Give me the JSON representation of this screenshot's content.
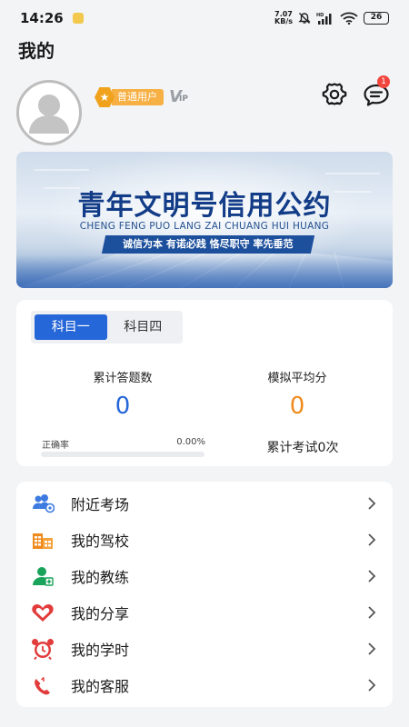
{
  "status_bar": {
    "time": "14:26",
    "net_speed_value": "7.07",
    "net_speed_unit": "KB/s",
    "battery": "26"
  },
  "header": {
    "title": "我的"
  },
  "profile": {
    "user_type": "普通用户",
    "vip_v": "V",
    "vip_ip": "IP",
    "message_count": "1"
  },
  "banner": {
    "title": "青年文明号信用公约",
    "subtitle": "CHENG FENG PUO LANG ZAI CHUANG HUI HUANG",
    "slogan": "诚信为本 有诺必践 恪尽职守 率先垂范"
  },
  "stats": {
    "tabs": [
      {
        "label": "科目一",
        "active": true
      },
      {
        "label": "科目四",
        "active": false
      }
    ],
    "answered_label": "累计答题数",
    "answered_value": "0",
    "answered_color": "#2566d8",
    "avg_label": "模拟平均分",
    "avg_value": "0",
    "avg_color": "#f08a1c",
    "accuracy_label": "正确率",
    "accuracy_value": "0.00%",
    "accuracy_fraction": 0.0,
    "exam_count": "累计考试0次"
  },
  "menu": {
    "items": [
      {
        "label": "附近考场",
        "icon": "nearby-exam-icon"
      },
      {
        "label": "我的驾校",
        "icon": "school-building-icon"
      },
      {
        "label": "我的教练",
        "icon": "coach-icon"
      },
      {
        "label": "我的分享",
        "icon": "share-heart-icon"
      },
      {
        "label": "我的学时",
        "icon": "alarm-clock-icon"
      },
      {
        "label": "我的客服",
        "icon": "phone-icon"
      }
    ]
  }
}
